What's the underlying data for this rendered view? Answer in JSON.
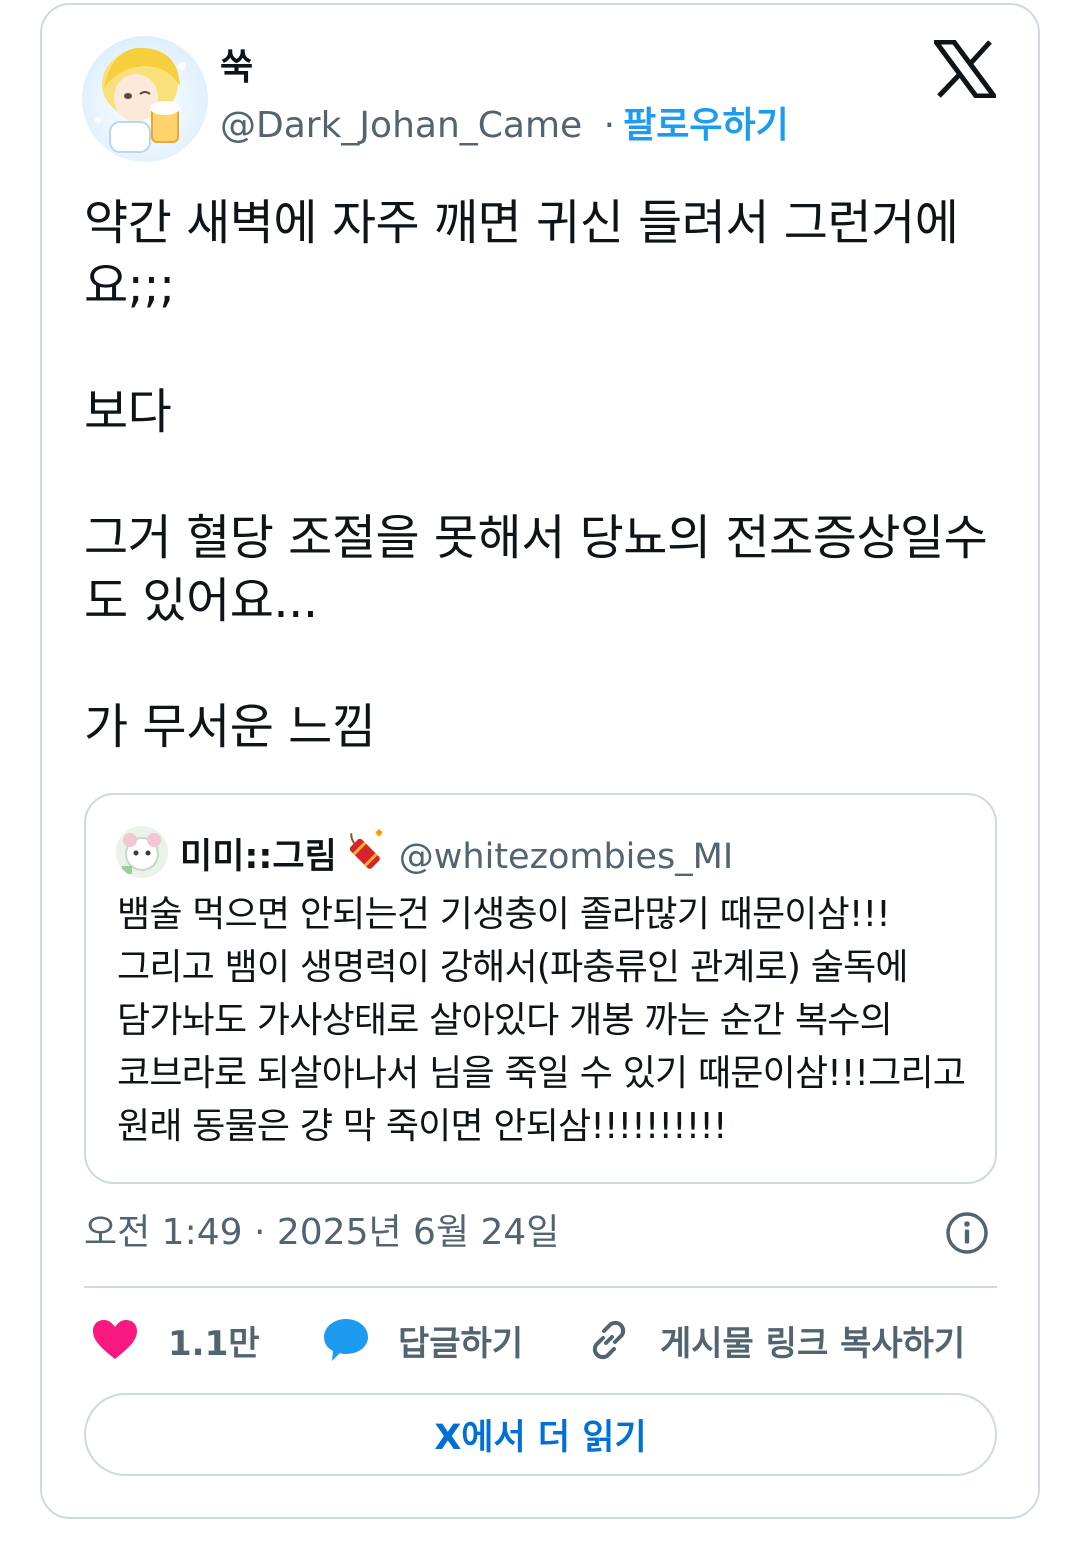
{
  "tweet": {
    "author": {
      "display_name": "쑥",
      "handle": "@Dark_Johan_Came",
      "separator": "·",
      "follow_label": "팔로우하기"
    },
    "text": "약간 새벽에 자주 깨면 귀신 들려서 그런거에요;;;\n\n보다\n\n그거 혈당 조절을 못해서 당뇨의 전조증상일수도 있어요...\n\n가 무서운 느낌",
    "quoted": {
      "display_name": "미미::그림",
      "handle": "@whitezombies_MI",
      "text": "뱀술 먹으면 안되는건 기생충이 졸라많기 때문이삼!!!그리고 뱀이 생명력이 강해서(파충류인 관계로) 술독에 담가놔도 가사상태로 살아있다 개봉 까는 순간 복수의 코브라로 되살아나서 님을 죽일 수 있기 때문이삼!!!그리고 원래 동물은 걍 막 죽이면 안되삼!!!!!!!!!!"
    },
    "timestamp": "오전 1:49 · 2025년 6월 24일",
    "actions": {
      "likes": "1.1만",
      "reply_label": "답글하기",
      "copy_link_label": "게시물 링크 복사하기"
    },
    "read_more_label": "X에서 더 읽기"
  },
  "colors": {
    "accent": "#1d9bf0",
    "link_button_text": "#006fd6",
    "like_heart": "#f91880",
    "reply_bubble": "#1d9bf0",
    "secondary_text": "#536471",
    "border": "#cfd9de"
  },
  "icons": {
    "brand": "x-logo-icon",
    "info": "info-icon",
    "like": "heart-icon",
    "reply": "speech-bubble-icon",
    "copy_link": "link-icon",
    "name_emoji": "firecracker-icon"
  }
}
